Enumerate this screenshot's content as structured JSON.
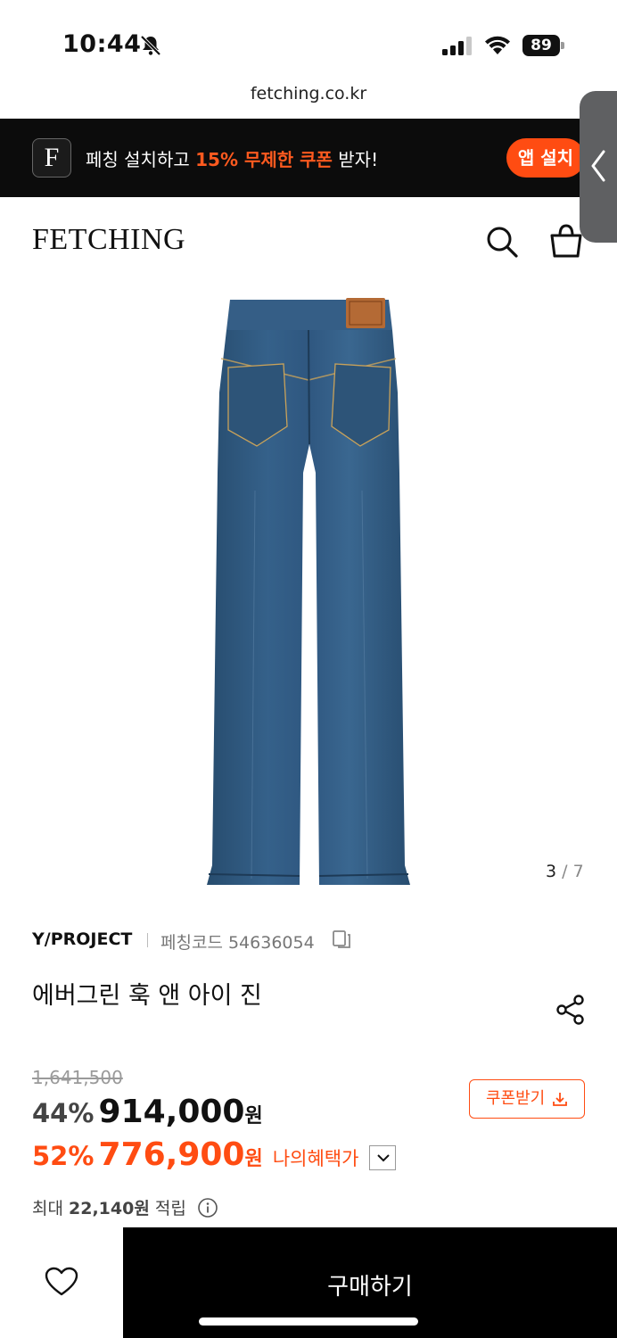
{
  "status_bar": {
    "time": "10:44",
    "battery": "89"
  },
  "browser": {
    "url": "fetching.co.kr"
  },
  "app_banner": {
    "logo_letter": "F",
    "text_pre": "페칭 설치하고 ",
    "text_highlight": "15% 무제한 쿠폰",
    "text_post": " 받자!",
    "install_label": "앱 설치",
    "accent_color": "#ff4c12"
  },
  "header": {
    "logo": "FETCHING",
    "icons": [
      "search-icon",
      "shopping-bag-icon"
    ]
  },
  "gallery": {
    "current": "3",
    "total": "7"
  },
  "product": {
    "brand": "Y/PROJECT",
    "code_label": "페칭코드",
    "code": "54636054",
    "title": "에버그린 훅 앤 아이 진",
    "original_price": "1,641,500",
    "sale_percent": "44%",
    "sale_price": "914,000",
    "currency": "원",
    "my_percent": "52%",
    "my_price": "776,900",
    "my_benefit_label": "나의혜택가",
    "coupon_label": "쿠폰받기",
    "points_prefix": "최대",
    "points_value": "22,140원",
    "points_suffix": "적립"
  },
  "bottom_bar": {
    "buy_label": "구매하기"
  }
}
